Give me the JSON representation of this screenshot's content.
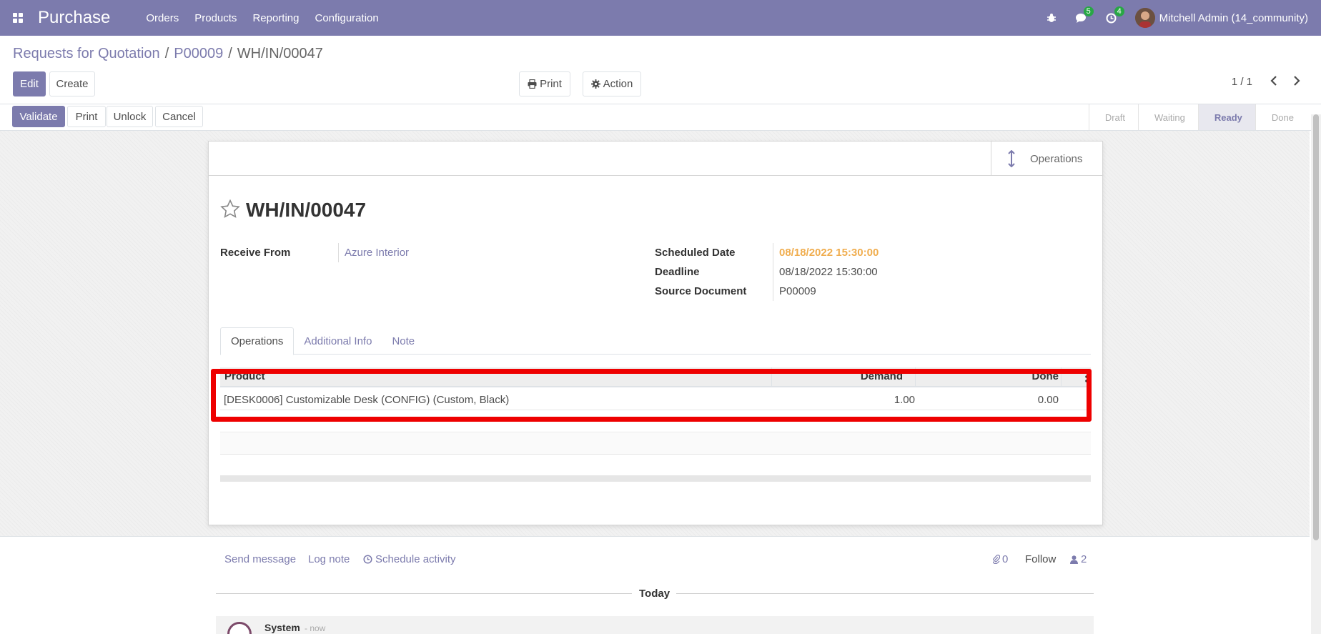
{
  "navbar": {
    "app_name": "Purchase",
    "menu": [
      "Orders",
      "Products",
      "Reporting",
      "Configuration"
    ],
    "messages_count": "5",
    "activities_count": "4",
    "user_name": "Mitchell Admin (14_community)",
    "bg_color": "#7c7bad"
  },
  "breadcrumb": {
    "items": [
      "Requests for Quotation",
      "P00009"
    ],
    "current": "WH/IN/00047"
  },
  "control_panel": {
    "edit": "Edit",
    "create": "Create",
    "print": "Print",
    "action": "Action",
    "pager": "1 / 1"
  },
  "statusbar": {
    "buttons": [
      "Validate",
      "Print",
      "Unlock",
      "Cancel"
    ],
    "stages": [
      "Draft",
      "Waiting",
      "Ready",
      "Done"
    ],
    "active_stage": "Ready"
  },
  "sheet": {
    "smart_button": "Operations",
    "title": "WH/IN/00047",
    "fields": {
      "receive_from_label": "Receive From",
      "receive_from_value": "Azure Interior",
      "scheduled_date_label": "Scheduled Date",
      "scheduled_date_value": "08/18/2022 15:30:00",
      "deadline_label": "Deadline",
      "deadline_value": "08/18/2022 15:30:00",
      "source_document_label": "Source Document",
      "source_document_value": "P00009"
    },
    "tabs": [
      "Operations",
      "Additional Info",
      "Note"
    ],
    "table": {
      "headers": [
        "Product",
        "Demand",
        "Done"
      ],
      "rows": [
        {
          "product": "[DESK0006] Customizable Desk (CONFIG) (Custom, Black)",
          "demand": "1.00",
          "done": "0.00"
        }
      ]
    }
  },
  "chatter": {
    "send_message": "Send message",
    "log_note": "Log note",
    "schedule_activity": "Schedule activity",
    "attachments": "0",
    "follow": "Follow",
    "followers": "2",
    "today": "Today",
    "message_author": "System",
    "message_time": "- now"
  }
}
